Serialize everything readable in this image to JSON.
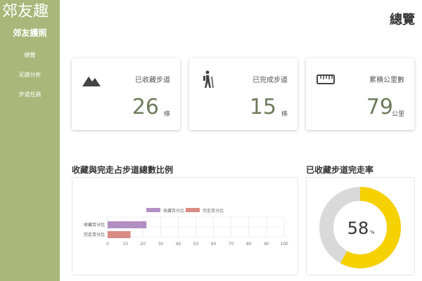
{
  "sidebar": {
    "app_title": "郊友趣",
    "passport": "郊友護照",
    "items": [
      {
        "label": "總覽"
      },
      {
        "label": "足跡分析"
      },
      {
        "label": "步道任務"
      }
    ]
  },
  "header": {
    "title": "總覽"
  },
  "cards": [
    {
      "label": "已收藏步道",
      "value": "26",
      "unit": "條",
      "icon": "mountain-icon"
    },
    {
      "label": "已完成步道",
      "value": "15",
      "unit": "條",
      "icon": "hiker-icon"
    },
    {
      "label": "累積公里數",
      "value": "79",
      "unit": "公里",
      "icon": "ruler-icon"
    }
  ],
  "bar_section": {
    "title": "收藏與完走占步道總數比例"
  },
  "donut_section": {
    "title": "已收藏步道完走率"
  },
  "colors": {
    "sidebar": "#a9b77a",
    "value_text": "#6f7c5d",
    "series_collected": "#b28fc2",
    "series_completed": "#d98a82",
    "donut_fill": "#f6d100",
    "donut_track": "#d9d9d9"
  },
  "chart_data": [
    {
      "type": "bar",
      "orientation": "horizontal",
      "categories": [
        "收藏百分比",
        "完走百分比"
      ],
      "series": [
        {
          "name": "收藏百分比",
          "values": [
            22,
            null
          ],
          "color": "#b28fc2"
        },
        {
          "name": "完走百分比",
          "values": [
            null,
            13
          ],
          "color": "#d98a82"
        }
      ],
      "xlim": [
        0,
        100
      ],
      "xticks": [
        "0",
        "10",
        "20",
        "30",
        "40",
        "50",
        "60",
        "70",
        "80",
        "90",
        "100"
      ],
      "grid": true,
      "legend": "top"
    },
    {
      "type": "pie",
      "variant": "donut",
      "values": [
        58,
        42
      ],
      "center_label": "58",
      "center_unit": "%"
    }
  ]
}
